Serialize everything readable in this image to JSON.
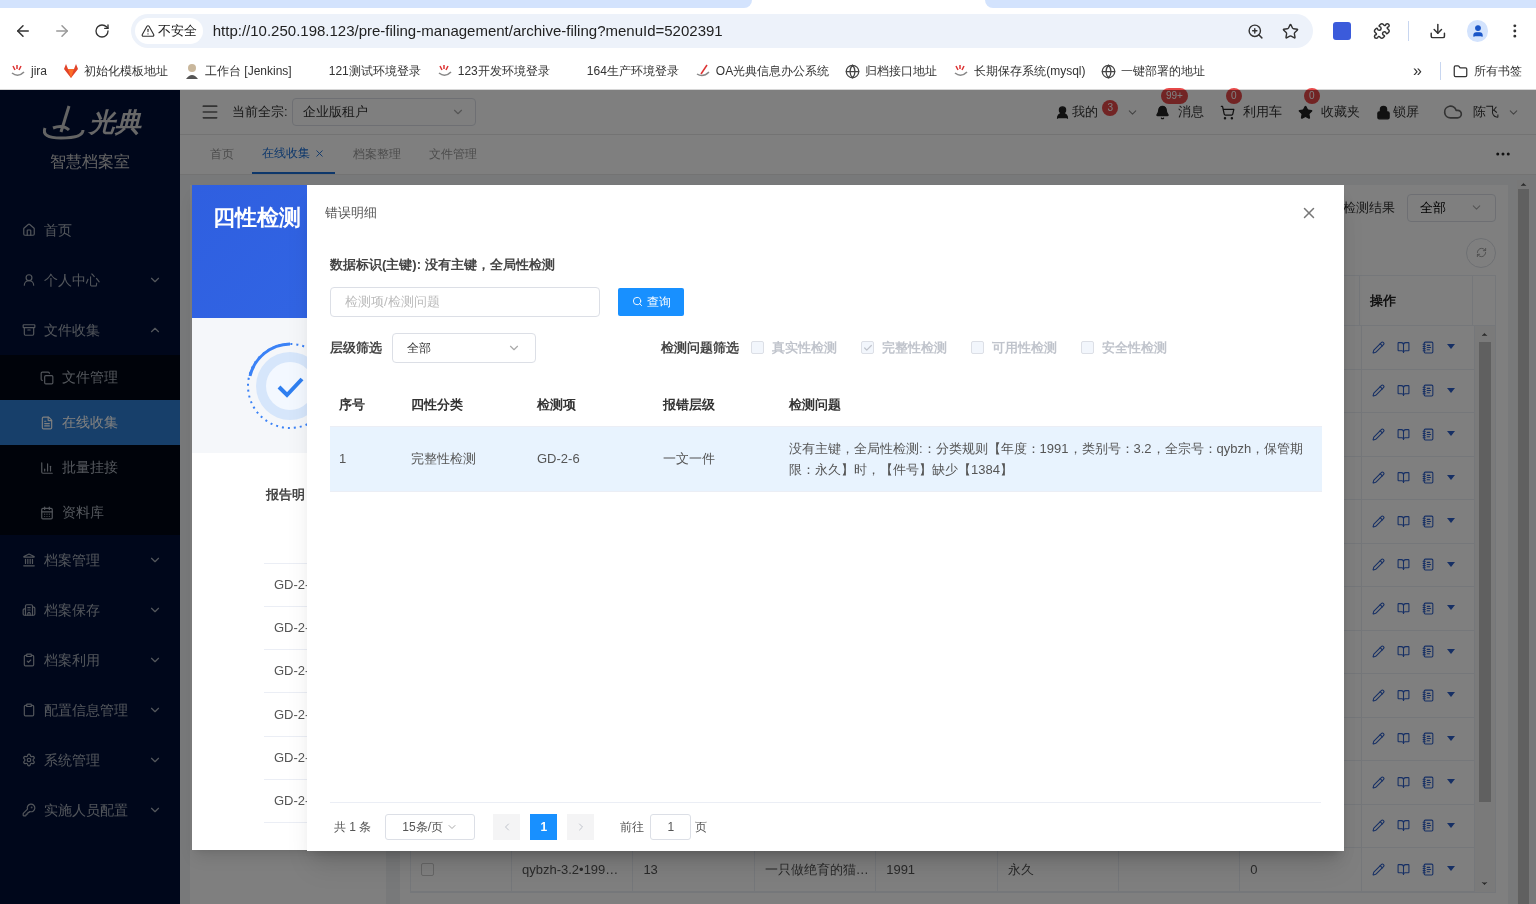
{
  "browser": {
    "security_label": "不安全",
    "url": "http://10.250.198.123/pre-filing-management/archive-filing?menuId=5202391",
    "bookmarks": [
      {
        "label": "jira"
      },
      {
        "label": "初始化模板地址"
      },
      {
        "label": "工作台 [Jenkins]"
      },
      {
        "label": "121测试环境登录"
      },
      {
        "label": "123开发环境登录"
      },
      {
        "label": "164生产环境登录"
      },
      {
        "label": "OA光典信息办公系统"
      },
      {
        "label": "归档接口地址"
      },
      {
        "label": "长期保存系统(mysql)"
      },
      {
        "label": "一键部署的地址"
      }
    ],
    "overflow": "»",
    "all_bookmarks": "所有书签"
  },
  "sidebar": {
    "brand": "光典",
    "subtitle": "智慧档案室",
    "items": [
      {
        "label": "首页",
        "selected": false
      },
      {
        "label": "个人中心",
        "selected": false,
        "expanded": false
      },
      {
        "label": "文件收集",
        "selected": false,
        "expanded": true,
        "children": [
          {
            "label": "文件管理",
            "selected": false
          },
          {
            "label": "在线收集",
            "selected": true
          },
          {
            "label": "批量挂接",
            "selected": false
          },
          {
            "label": "资料库",
            "selected": false
          }
        ]
      },
      {
        "label": "档案管理",
        "selected": false,
        "expanded": false
      },
      {
        "label": "档案保存",
        "selected": false,
        "expanded": false
      },
      {
        "label": "档案利用",
        "selected": false,
        "expanded": false
      },
      {
        "label": "配置信息管理",
        "selected": false,
        "expanded": false
      },
      {
        "label": "系统管理",
        "selected": false,
        "expanded": false
      },
      {
        "label": "实施人员配置",
        "selected": false,
        "expanded": false
      }
    ]
  },
  "header": {
    "fonds_label": "当前全宗:",
    "fonds_value": "企业版租户",
    "user_menu": [
      {
        "label": "我的",
        "badge": "3"
      },
      {
        "label": "消息",
        "badge": "99+"
      },
      {
        "label": "利用车",
        "badge": "0"
      },
      {
        "label": "收藏夹",
        "badge": "0"
      },
      {
        "label": "锁屏"
      },
      {
        "label": "陈飞"
      }
    ]
  },
  "tabs": [
    {
      "label": "首页",
      "selected": false,
      "closable": false
    },
    {
      "label": "在线收集",
      "selected": true,
      "closable": true
    },
    {
      "label": "档案整理",
      "selected": false,
      "closable": false
    },
    {
      "label": "文件管理",
      "selected": false,
      "closable": false
    }
  ],
  "page": {
    "result_label": "检测结果",
    "result_value": "全部",
    "action_header": "操作",
    "records": [
      {
        "checked": false,
        "cells": {
          "column_1": "qybzh-3.2•199…",
          "column_2": "13",
          "column_3": "一只做绝育的猫…",
          "column_4": "1991",
          "column_5": "永久",
          "column_7": "0"
        }
      }
    ]
  },
  "report_dialog": {
    "title": "四性检测",
    "section": "报告明",
    "rows": [
      "GD-2-",
      "GD-2-",
      "GD-2-",
      "GD-2-",
      "GD-2-",
      "GD-2-"
    ]
  },
  "error_dialog": {
    "title": "错误明细",
    "key_label": "数据标识(主键): 没有主键，全局性检测",
    "search": {
      "placeholder": "检测项/检测问题"
    },
    "search_button": "查询",
    "level_filter_label": "层级筛选",
    "level_filter_value": "全部",
    "issue_filter_label": "检测问题筛选",
    "issue_filters": [
      {
        "label": "真实性检测",
        "checked": false,
        "disabled": true
      },
      {
        "label": "完整性检测",
        "checked": true,
        "disabled": true
      },
      {
        "label": "可用性检测",
        "checked": false,
        "disabled": true
      },
      {
        "label": "安全性检测",
        "checked": false,
        "disabled": true
      }
    ],
    "table": {
      "columns": [
        "序号",
        "四性分类",
        "检测项",
        "报错层级",
        "检测问题"
      ],
      "rows": [
        {
          "highlighted": true,
          "cells": [
            "1",
            "完整性检测",
            "GD-2-6",
            "一文一件",
            "没有主键，全局性检测:：分类规则【年度：1991，类别号：3.2，全宗号：qybzh，保管期限：永久】时，【件号】缺少【1384】"
          ]
        }
      ]
    },
    "pagination": {
      "total": "共 1 条",
      "page_size": "15条/页",
      "pages": [
        {
          "label": "1",
          "selected": true
        }
      ],
      "goto_label": "前往",
      "goto_value": "1",
      "goto_suffix": "页"
    }
  }
}
